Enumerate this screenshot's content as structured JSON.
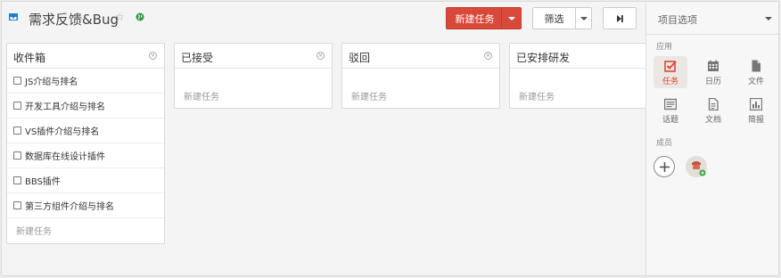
{
  "header": {
    "project_title": "需求反馈&Bug",
    "new_task_label": "新建任务",
    "filter_label": "筛选"
  },
  "columns": [
    {
      "title": "收件箱",
      "tasks": [
        "JS介绍与排名",
        "开发工具介绍与排名",
        "VS插件介绍与排名",
        "数据库在线设计插件",
        "BBS插件",
        "第三方组件介绍与排名"
      ],
      "new_task": "新建任务"
    },
    {
      "title": "已接受",
      "tasks": [],
      "new_task": "新建任务"
    },
    {
      "title": "驳回",
      "tasks": [],
      "new_task": "新建任务"
    },
    {
      "title": "已安排研发",
      "tasks": [],
      "new_task": "新建任务"
    }
  ],
  "sidebar": {
    "title": "项目选项",
    "apps_section": "应用",
    "apps": [
      {
        "label": "任务",
        "icon": "check-square-icon",
        "active": true
      },
      {
        "label": "日历",
        "icon": "calendar-icon",
        "active": false
      },
      {
        "label": "文件",
        "icon": "file-icon",
        "active": false
      },
      {
        "label": "话题",
        "icon": "topic-icon",
        "active": false
      },
      {
        "label": "文档",
        "icon": "document-icon",
        "active": false
      },
      {
        "label": "简报",
        "icon": "report-icon",
        "active": false
      }
    ],
    "members_section": "成员"
  },
  "colors": {
    "accent": "#d9493a",
    "background": "#f4f4f4",
    "card": "#ffffff",
    "sidebar": "#f7f7f7"
  }
}
